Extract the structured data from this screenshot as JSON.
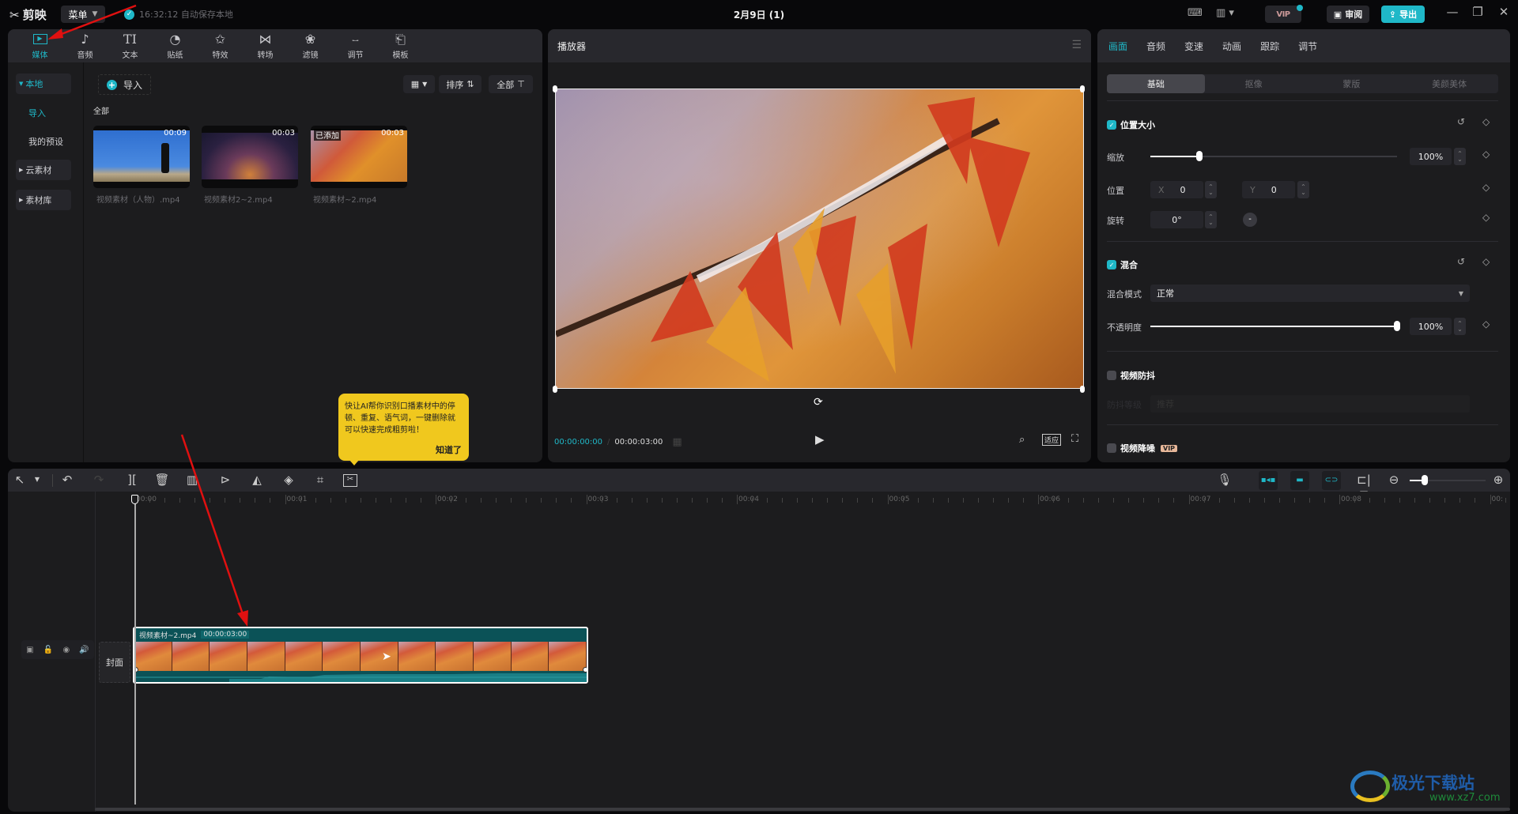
{
  "app": {
    "name": "剪映",
    "menu_label": "菜单",
    "save_status": "16:32:12 自动保存本地",
    "project_title": "2月9日 (1)"
  },
  "topbar": {
    "vip_label": "VIP",
    "review_label": "审阅",
    "export_label": "导出",
    "minimize": "—",
    "maximize": "❐",
    "close": "✕"
  },
  "media_tabs": [
    {
      "label": "媒体",
      "icon": "media-icon",
      "glyph": "▶",
      "active": true
    },
    {
      "label": "音频",
      "icon": "audio-icon",
      "glyph": "♪"
    },
    {
      "label": "文本",
      "icon": "text-icon",
      "glyph": "TI"
    },
    {
      "label": "贴纸",
      "icon": "sticker-icon",
      "glyph": "◔"
    },
    {
      "label": "特效",
      "icon": "effects-icon",
      "glyph": "✩"
    },
    {
      "label": "转场",
      "icon": "transition-icon",
      "glyph": "⋈"
    },
    {
      "label": "滤镜",
      "icon": "filter-icon",
      "glyph": "❀"
    },
    {
      "label": "调节",
      "icon": "adjust-icon",
      "glyph": "⧿"
    },
    {
      "label": "模板",
      "icon": "template-icon",
      "glyph": "⎗"
    }
  ],
  "media_sidebar": {
    "local": "本地",
    "import": "导入",
    "presets": "我的预设",
    "cloud": "云素材",
    "library": "素材库"
  },
  "media_panel": {
    "import_label": "导入",
    "sort_label": "排序",
    "filter_label": "全部",
    "section_label": "全部",
    "items": [
      {
        "name": "视频素材（人物）.mp4",
        "duration": "00:09",
        "added": ""
      },
      {
        "name": "视频素材2~2.mp4",
        "duration": "00:03",
        "added": ""
      },
      {
        "name": "视频素材~2.mp4",
        "duration": "00:03",
        "added": "已添加"
      }
    ]
  },
  "tooltip": {
    "text": "快让AI帮你识别口播素材中的停顿、重复、语气词，一键删除就可以快速完成粗剪啦！",
    "ok_label": "知道了"
  },
  "player": {
    "title": "播放器",
    "current_time": "00:00:00:00",
    "total_time": "00:00:03:00",
    "fit_label": "适应"
  },
  "properties": {
    "tabs": [
      "画面",
      "音频",
      "变速",
      "动画",
      "跟踪",
      "调节"
    ],
    "active_tab": "画面",
    "sub_tabs": [
      "基础",
      "抠像",
      "蒙版",
      "美颜美体"
    ],
    "position_size": {
      "title": "位置大小",
      "enabled": true,
      "scale_label": "缩放",
      "scale_value": "100%",
      "scale_slider_fraction": 0.2,
      "position_label": "位置",
      "x_label": "X",
      "x_value": "0",
      "y_label": "Y",
      "y_value": "0",
      "rotation_label": "旋转",
      "rotation_value": "0°"
    },
    "blend": {
      "title": "混合",
      "enabled": true,
      "mode_label": "混合模式",
      "mode_value": "正常",
      "opacity_label": "不透明度",
      "opacity_value": "100%",
      "opacity_fraction": 1.0
    },
    "stabilize": {
      "title": "视频防抖",
      "enabled": false,
      "level_label": "防抖等级",
      "level_value": "推荐"
    },
    "denoise": {
      "title": "视频降噪",
      "enabled": false,
      "badge": "VIP"
    }
  },
  "timeline": {
    "ruler": [
      "00:00",
      "00:01",
      "00:02",
      "00:03",
      "00:04",
      "00:05",
      "00:06",
      "00:07",
      "00:08",
      "00:"
    ],
    "cover_label": "封面",
    "clip": {
      "name": "视频素材~2.mp4",
      "duration": "00:00:03:00"
    },
    "zoom_fraction": 0.2
  },
  "watermark": {
    "name": "极光下载站",
    "url": "www.xz7.com"
  },
  "colors": {
    "accent": "#1fb8c8",
    "tooltip": "#f0c81e",
    "clip": "#0b5257"
  }
}
